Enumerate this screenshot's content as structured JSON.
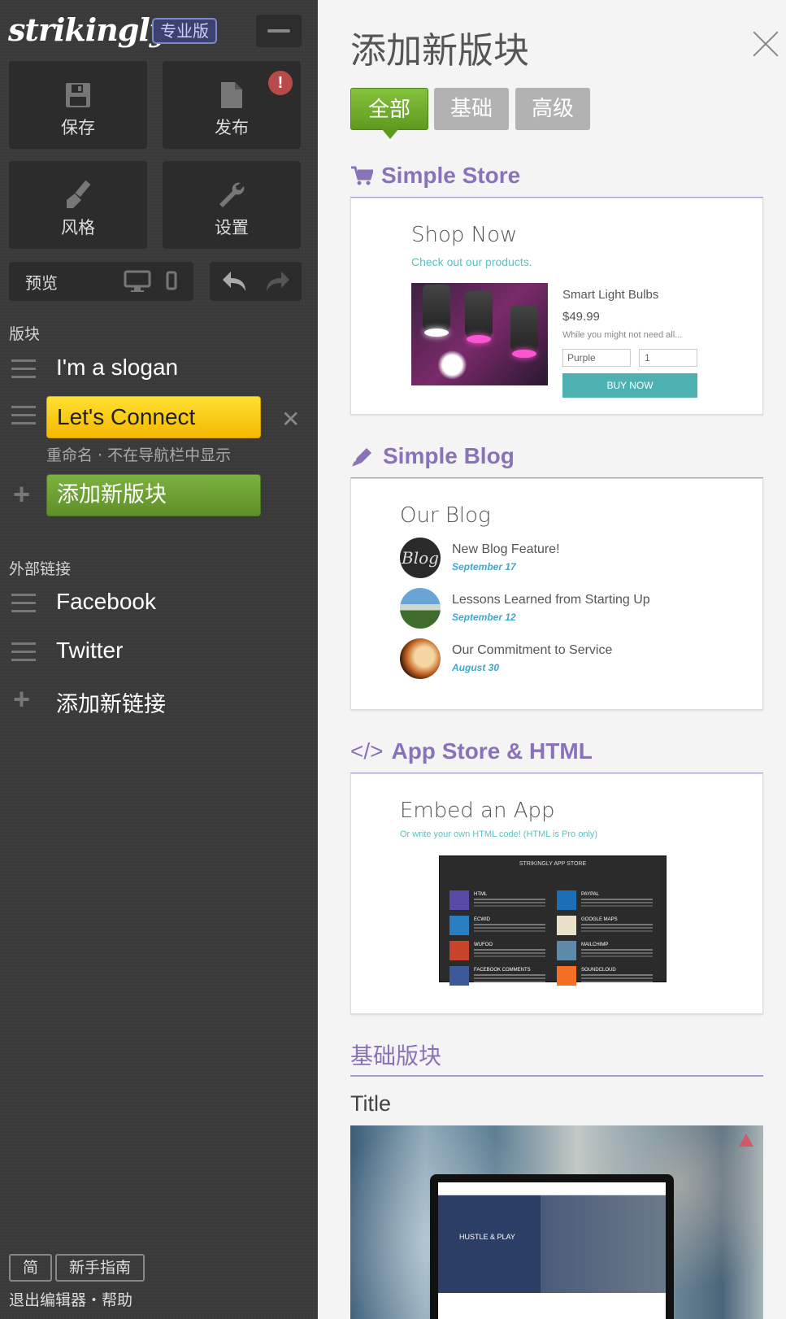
{
  "sidebar": {
    "logo": "strikingly",
    "pro_badge": "专业版",
    "tiles": {
      "save": "保存",
      "publish": "发布",
      "style": "风格",
      "settings": "设置"
    },
    "publish_alert": "!",
    "preview": "预览",
    "sections_label": "版块",
    "sections": [
      {
        "label": "I'm a slogan"
      },
      {
        "label": "Let's Connect"
      }
    ],
    "section_actions": "重命名 · 不在导航栏中显示",
    "add_section": "添加新版块",
    "external_label": "外部链接",
    "links": [
      {
        "label": "Facebook"
      },
      {
        "label": "Twitter"
      }
    ],
    "add_link": "添加新链接",
    "lang_btn": "简",
    "guide_btn": "新手指南",
    "footer": "退出编辑器・帮助"
  },
  "panel": {
    "title": "添加新版块",
    "tabs": [
      {
        "label": "全部"
      },
      {
        "label": "基础"
      },
      {
        "label": "高级"
      }
    ],
    "store": {
      "heading": "Simple Store",
      "title": "Shop Now",
      "subtitle": "Check out our products.",
      "product_name": "Smart Light Bulbs",
      "price": "$49.99",
      "desc": "While you might not need all...",
      "option": "Purple",
      "qty": "1",
      "buy": "BUY NOW"
    },
    "blog": {
      "heading": "Simple Blog",
      "title": "Our Blog",
      "thumb_text": "Blog",
      "posts": [
        {
          "title": "New Blog Feature!",
          "date": "September 17"
        },
        {
          "title": "Lessons Learned from Starting Up",
          "date": "September 12"
        },
        {
          "title": "Our Commitment to Service",
          "date": "August 30"
        }
      ]
    },
    "app": {
      "heading_icon": "</>",
      "heading": "App Store & HTML",
      "title": "Embed an App",
      "subtitle": "Or write your own HTML code! (HTML is Pro only)",
      "shot_title": "STRIKINGLY APP STORE",
      "apps": [
        {
          "name": "HTML"
        },
        {
          "name": "PAYPAL"
        },
        {
          "name": "ECWID"
        },
        {
          "name": "GOOGLE MAPS"
        },
        {
          "name": "WUFOO"
        },
        {
          "name": "MAILCHIMP"
        },
        {
          "name": "FACEBOOK COMMENTS"
        },
        {
          "name": "SOUNDCLOUD"
        }
      ]
    },
    "basic_heading": "基础版块",
    "title_section_label": "Title",
    "title_preview_text": "HUSTLE & PLAY"
  },
  "colors": {
    "accent_purple": "#8a72b8",
    "green": "#6aa52c",
    "yellow": "#f7c600",
    "teal": "#4eb1b1",
    "sidebar_bg": "#3a3a3a"
  }
}
